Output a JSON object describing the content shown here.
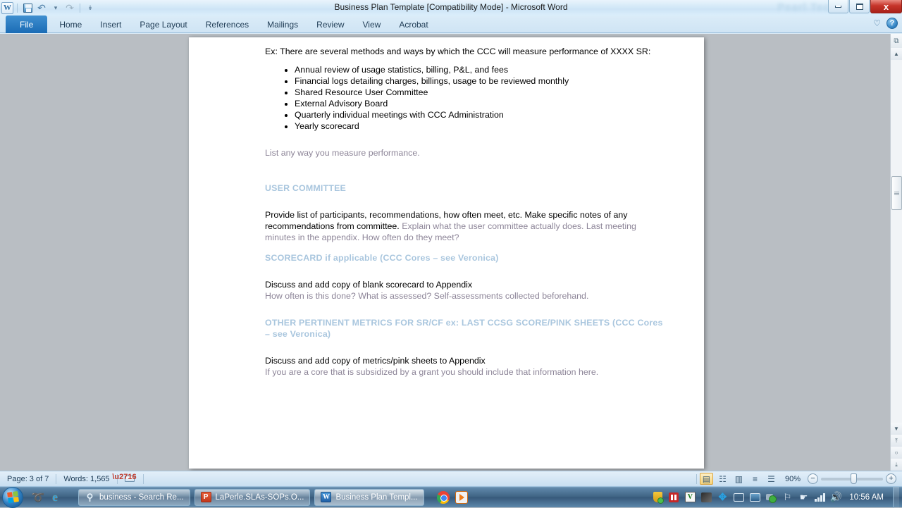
{
  "window": {
    "title": "Business Plan Template [Compatibility Mode]  -  Microsoft Word",
    "watermark": "Pearl Tech",
    "minimize_label": "",
    "maximize_label": "",
    "close_label": "x"
  },
  "quick_access": {
    "app_logo": "W",
    "items": [
      {
        "name": "save",
        "label": ""
      },
      {
        "name": "undo",
        "label": "↶"
      },
      {
        "name": "undo-dropdown",
        "label": "▾"
      },
      {
        "name": "redo",
        "label": "↷"
      },
      {
        "name": "customize-qat",
        "label": "↡"
      }
    ]
  },
  "ribbon": {
    "tabs": [
      {
        "id": "file",
        "label": "File"
      },
      {
        "id": "home",
        "label": "Home"
      },
      {
        "id": "insert",
        "label": "Insert"
      },
      {
        "id": "page-layout",
        "label": "Page Layout"
      },
      {
        "id": "references",
        "label": "References"
      },
      {
        "id": "mailings",
        "label": "Mailings"
      },
      {
        "id": "review",
        "label": "Review"
      },
      {
        "id": "view",
        "label": "View"
      },
      {
        "id": "acrobat",
        "label": "Acrobat"
      }
    ],
    "active_tab": "File",
    "heart_icon": "♡",
    "help_icon": "?"
  },
  "document": {
    "intro": "Ex: There are several methods and ways by which the CCC will measure performance of XXXX SR:",
    "bullets": [
      "Annual review of usage statistics, billing, P&L, and fees",
      "Financial logs detailing charges, billings, usage to be reviewed monthly",
      "Shared Resource User Committee",
      "External Advisory Board",
      "Quarterly individual meetings with CCC Administration",
      "Yearly scorecard"
    ],
    "hint_after_bullets": "List any way you measure performance.",
    "section_user_committee": {
      "heading": "USER COMMITTEE",
      "body_black": "Provide list of participants, recommendations,  how often meet, etc. Make specific notes of any recommendations  from committee.",
      "body_hint": "Explain what the user committee actually  does. Last meeting minutes in the appendix. How often do they meet?"
    },
    "section_scorecard": {
      "heading": "SCORECARD  if applicable (CCC Cores – see Veronica)",
      "body_black": "Discuss and add copy of blank scorecard to Appendix",
      "body_hint": "How often is this done? What is assessed? Self-assessments  collected beforehand."
    },
    "section_other_metrics": {
      "heading": "OTHER PERTINENT METRICS FOR SR/CF ex: LAST CCSG  SCORE/PINK SHEETS (CCC Cores – see Veronica)",
      "body_black": "Discuss and add copy of metrics/pink sheets to Appendix",
      "body_hint": "If you are a core that is subsidized by a grant you should include that information here."
    },
    "colors": {
      "heading_blue": "#a9c6de",
      "hint_mauve": "#8d8598",
      "body_black": "#000000"
    }
  },
  "scrollbar": {
    "select_browse_object_icon": "⧉",
    "up_arrow": "▲",
    "down_arrow": "▼",
    "prev_page": "⤒",
    "browse_dot": "○",
    "next_page": "⤓"
  },
  "status_bar": {
    "page": "Page: 3 of 7",
    "words": "Words: 1,565",
    "proofing_icon": "proofing-errors-icon",
    "views": [
      {
        "id": "print-layout",
        "icon": "▤",
        "active": true
      },
      {
        "id": "full-screen-reading",
        "icon": "☷",
        "active": false
      },
      {
        "id": "web-layout",
        "icon": "▥",
        "active": false
      },
      {
        "id": "outline",
        "icon": "≡",
        "active": false
      },
      {
        "id": "draft",
        "icon": "☰",
        "active": false
      }
    ],
    "zoom_level": "90%",
    "zoom_out": "−",
    "zoom_in": "+"
  },
  "taskbar": {
    "start_label": "Start",
    "quick_launch": [
      {
        "id": "show-desktop-swirl",
        "icon": "➰"
      },
      {
        "id": "internet-explorer",
        "icon": "e"
      }
    ],
    "tasks": [
      {
        "id": "browser-search",
        "label": "business - Search Re...",
        "icon": "⚲",
        "icon_kind": "srch",
        "active": false
      },
      {
        "id": "powerpoint-laperle",
        "label": "LaPerle.SLAs-SOPs.O...",
        "icon": "P",
        "icon_kind": "ppt",
        "active": false
      },
      {
        "id": "word-business-plan",
        "label": "Business Plan Templ...",
        "icon": "W",
        "icon_kind": "word",
        "active": true
      }
    ],
    "apps": [
      {
        "id": "chrome",
        "label": ""
      },
      {
        "id": "vlc",
        "label": ""
      }
    ],
    "tray": [
      {
        "id": "security-shield"
      },
      {
        "id": "media-pause"
      },
      {
        "id": "vmware"
      },
      {
        "id": "black-tool"
      },
      {
        "id": "bluetooth"
      },
      {
        "id": "network-monitor"
      },
      {
        "id": "remote-display"
      },
      {
        "id": "sync-ok"
      },
      {
        "id": "action-center-flag"
      },
      {
        "id": "hand-pointer"
      },
      {
        "id": "signal-bars"
      },
      {
        "id": "volume"
      }
    ],
    "clock": "10:56 AM"
  }
}
